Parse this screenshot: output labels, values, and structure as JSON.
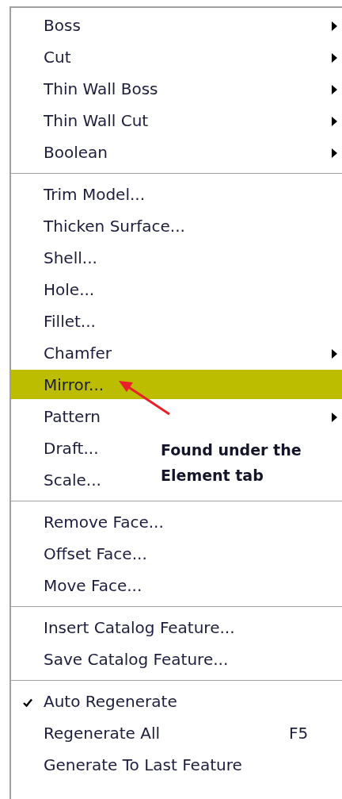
{
  "menu": {
    "sections": [
      {
        "items": [
          {
            "label": "Boss",
            "submenu": true,
            "selected": false,
            "checked": false
          },
          {
            "label": "Cut",
            "submenu": true,
            "selected": false,
            "checked": false
          },
          {
            "label": "Thin Wall Boss",
            "submenu": true,
            "selected": false,
            "checked": false
          },
          {
            "label": "Thin Wall Cut",
            "submenu": true,
            "selected": false,
            "checked": false
          },
          {
            "label": "Boolean",
            "submenu": true,
            "selected": false,
            "checked": false
          }
        ]
      },
      {
        "items": [
          {
            "label": "Trim Model...",
            "submenu": false,
            "selected": false,
            "checked": false
          },
          {
            "label": "Thicken Surface...",
            "submenu": false,
            "selected": false,
            "checked": false
          },
          {
            "label": "Shell...",
            "submenu": false,
            "selected": false,
            "checked": false
          },
          {
            "label": "Hole...",
            "submenu": false,
            "selected": false,
            "checked": false
          },
          {
            "label": "Fillet...",
            "submenu": false,
            "selected": false,
            "checked": false
          },
          {
            "label": "Chamfer",
            "submenu": true,
            "selected": false,
            "checked": false
          },
          {
            "label": "Mirror...",
            "submenu": false,
            "selected": true,
            "checked": false
          },
          {
            "label": "Pattern",
            "submenu": true,
            "selected": false,
            "checked": false
          },
          {
            "label": "Draft...",
            "submenu": false,
            "selected": false,
            "checked": false
          },
          {
            "label": "Scale...",
            "submenu": false,
            "selected": false,
            "checked": false
          }
        ]
      },
      {
        "items": [
          {
            "label": "Remove Face...",
            "submenu": false,
            "selected": false,
            "checked": false
          },
          {
            "label": "Offset Face...",
            "submenu": false,
            "selected": false,
            "checked": false
          },
          {
            "label": "Move Face...",
            "submenu": false,
            "selected": false,
            "checked": false
          }
        ]
      },
      {
        "items": [
          {
            "label": "Insert Catalog Feature...",
            "submenu": false,
            "selected": false,
            "checked": false
          },
          {
            "label": "Save Catalog Feature...",
            "submenu": false,
            "selected": false,
            "checked": false
          }
        ]
      },
      {
        "items": [
          {
            "label": "Auto Regenerate",
            "submenu": false,
            "selected": false,
            "checked": true
          },
          {
            "label": "Regenerate All",
            "shortcut": "F5",
            "submenu": false,
            "selected": false,
            "checked": false
          },
          {
            "label": "Generate To Last Feature",
            "submenu": false,
            "selected": false,
            "checked": false
          }
        ]
      }
    ]
  },
  "annotation": {
    "text": "Found under the Element tab"
  }
}
